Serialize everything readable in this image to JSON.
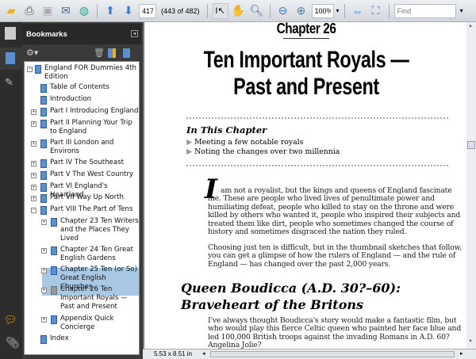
{
  "toolbar": {
    "page_input": "417",
    "page_count": "(443 of 482)",
    "zoom": "100%",
    "find_placeholder": "Find"
  },
  "bookmarks": {
    "title": "Bookmarks",
    "items": [
      {
        "label": "England FOR Dummies 4th Edition"
      },
      {
        "label": "Table of Contents"
      },
      {
        "label": "Introduction"
      },
      {
        "label": "Part I Introducing England"
      },
      {
        "label": "Part II Planning Your Trip to England"
      },
      {
        "label": "Part III London and Environs"
      },
      {
        "label": "Part IV The Southeast"
      },
      {
        "label": "Part V The West Country"
      },
      {
        "label": "Part VI England's Heartland"
      },
      {
        "label": "Part VII Way Up North"
      },
      {
        "label": "Part VIII The Part of Tens"
      },
      {
        "label": "Chapter 23 Ten Writers and the Places They Lived"
      },
      {
        "label": "Chapter 24 Ten Great English Gardens"
      },
      {
        "label": "Chapter 25 Ten (or So) Great English Churches"
      },
      {
        "label": "Chapter 26 Ten Important Royals —Past and Present"
      },
      {
        "label": "Appendix Quick Concierge"
      },
      {
        "label": "Index"
      }
    ]
  },
  "doc": {
    "chapter": "Chapter 26",
    "title1": "Ten Important Royals —",
    "title2": "Past and Present",
    "in_this_chapter": "In This Chapter",
    "bullets": [
      "Meeting a few notable royals",
      "Noting the changes over two millennia"
    ],
    "dropcap": "I",
    "p1": "am not a royalist, but the kings and queens of England fascinate me. These are people who lived lives of penultimate power and humiliating defeat, people who killed to stay on the throne and were killed by others who wanted it, people who inspired their subjects and treated them like dirt, people who sometimes changed the course of history and sometimes disgraced the nation they ruled.",
    "p2": "Choosing just ten is difficult, but in the thumbnail sketches that follow, you can get a glimpse of how the rulers of England — and the rule of England — has changed over the past 2,000 years.",
    "h1": "Queen Boudicca (A.D. 30?–60):",
    "h2": "Braveheart of the Britons",
    "p3": "I've always thought Boudicca's story would make a fantastic film, but who would play this fierce Celtic queen who painted her face blue and led 100,000 British troops against the invading Romans in A.D. 60? Angelina Jolie?"
  },
  "status": {
    "page_size": "5.53 x 8.51 in"
  }
}
